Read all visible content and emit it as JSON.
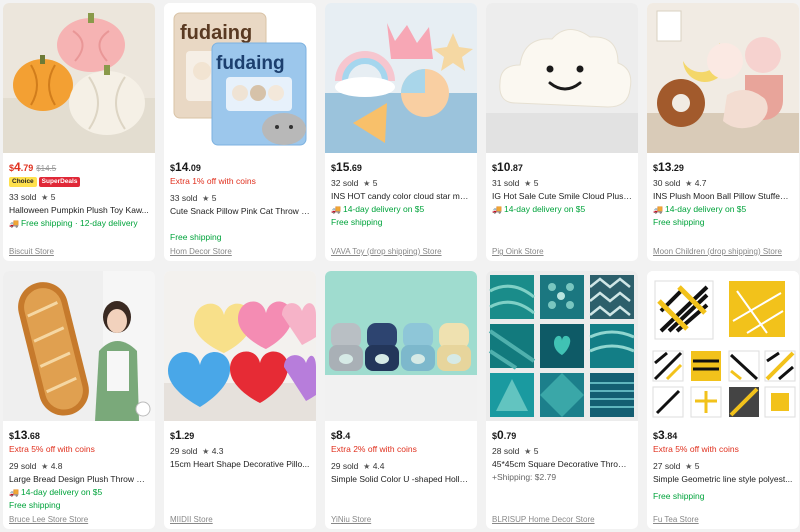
{
  "products": [
    {
      "sym": "$",
      "int": "4",
      "dec": ".79",
      "orig": "$14.5",
      "red": true,
      "badges": [
        "Choice",
        "SuperDeals"
      ],
      "promo": "",
      "sold": "33 sold",
      "rating": "5",
      "title": "Halloween Pumpkin Plush Toy Kaw...",
      "ship1": "Free shipping · 12-day delivery",
      "ship2": "",
      "store": "Biscuit Store",
      "image": "pumpkin-pillows"
    },
    {
      "sym": "$",
      "int": "14",
      "dec": ".09",
      "orig": "",
      "red": false,
      "badges": [],
      "promo": "Extra 1% off with coins",
      "sold": "33 sold",
      "rating": "5",
      "title": "Cute Snack Pillow Pink Cat Throw P...",
      "ship1": "",
      "ship2": "Free shipping",
      "store": "Hom Decor Store",
      "image": "fuddang-snack-bag"
    },
    {
      "sym": "$",
      "int": "15",
      "dec": ".69",
      "orig": "",
      "red": false,
      "badges": [],
      "promo": "",
      "sold": "32 sold",
      "rating": "5",
      "title": "INS HOT candy color cloud star mo...",
      "ship1": "14-day delivery on $5",
      "ship2": "Free shipping",
      "store": "VAVA Toy (drop shipping) Store",
      "image": "candy-cushions"
    },
    {
      "sym": "$",
      "int": "10",
      "dec": ".87",
      "orig": "",
      "red": false,
      "badges": [],
      "promo": "",
      "sold": "31 sold",
      "rating": "5",
      "title": "IG Hot Sale Cute Smile Cloud Plush ...",
      "ship1": "14-day delivery on $5",
      "ship2": "",
      "store": "Pig Oink Store",
      "image": "smile-cloud"
    },
    {
      "sym": "$",
      "int": "13",
      "dec": ".29",
      "orig": "",
      "red": false,
      "badges": [],
      "promo": "",
      "sold": "30 sold",
      "rating": "4.7",
      "title": "INS Plush Moon Ball Pillow Stuffed ...",
      "ship1": "14-day delivery on $5",
      "ship2": "Free shipping",
      "store": "Moon Children (drop shipping) Store",
      "image": "moon-ball-pillows"
    },
    {
      "sym": "$",
      "int": "13",
      "dec": ".68",
      "orig": "",
      "red": false,
      "badges": [],
      "promo": "Extra 5% off with coins",
      "sold": "29 sold",
      "rating": "4.8",
      "title": "Large Bread Design Plush Throw C...",
      "ship1": "14-day delivery on $5",
      "ship2": "Free shipping",
      "store": "Bruce Lee Store Store",
      "image": "bread-pillow"
    },
    {
      "sym": "$",
      "int": "1",
      "dec": ".29",
      "orig": "",
      "red": false,
      "badges": [],
      "promo": "",
      "sold": "29 sold",
      "rating": "4.3",
      "title": "15cm Heart Shape Decorative Pillo...",
      "ship1": "",
      "ship2": "",
      "store": "MIIDII Store",
      "image": "heart-pillows"
    },
    {
      "sym": "$",
      "int": "8",
      "dec": ".4",
      "orig": "",
      "red": false,
      "badges": [],
      "promo": "Extra 2% off with coins",
      "sold": "29 sold",
      "rating": "4.4",
      "title": "Simple Solid Color U -shaped Hollo...",
      "ship1": "",
      "ship2": "",
      "store": "YiNiu Store",
      "image": "u-shaped-cushions"
    },
    {
      "sym": "$",
      "int": "0",
      "dec": ".79",
      "orig": "",
      "red": false,
      "badges": [],
      "promo": "",
      "sold": "28 sold",
      "rating": "5",
      "title": "45*45cm Square Decorative Throw-...",
      "ship1": "",
      "ship2": "+Shipping: $2.79",
      "store": "BLRISUP Home Decor Store",
      "image": "teal-pillow-covers"
    },
    {
      "sym": "$",
      "int": "3",
      "dec": ".84",
      "orig": "",
      "red": false,
      "badges": [],
      "promo": "Extra 5% off with coins",
      "sold": "27 sold",
      "rating": "5",
      "title": "Simple Geometric line style polyest...",
      "ship1": "",
      "ship2": "Free shipping",
      "store": "Fu Tea Store",
      "image": "geometric-pillow-covers"
    }
  ],
  "colors": {
    "accent_red": "#e0301e",
    "ship_green": "#00a33b"
  }
}
